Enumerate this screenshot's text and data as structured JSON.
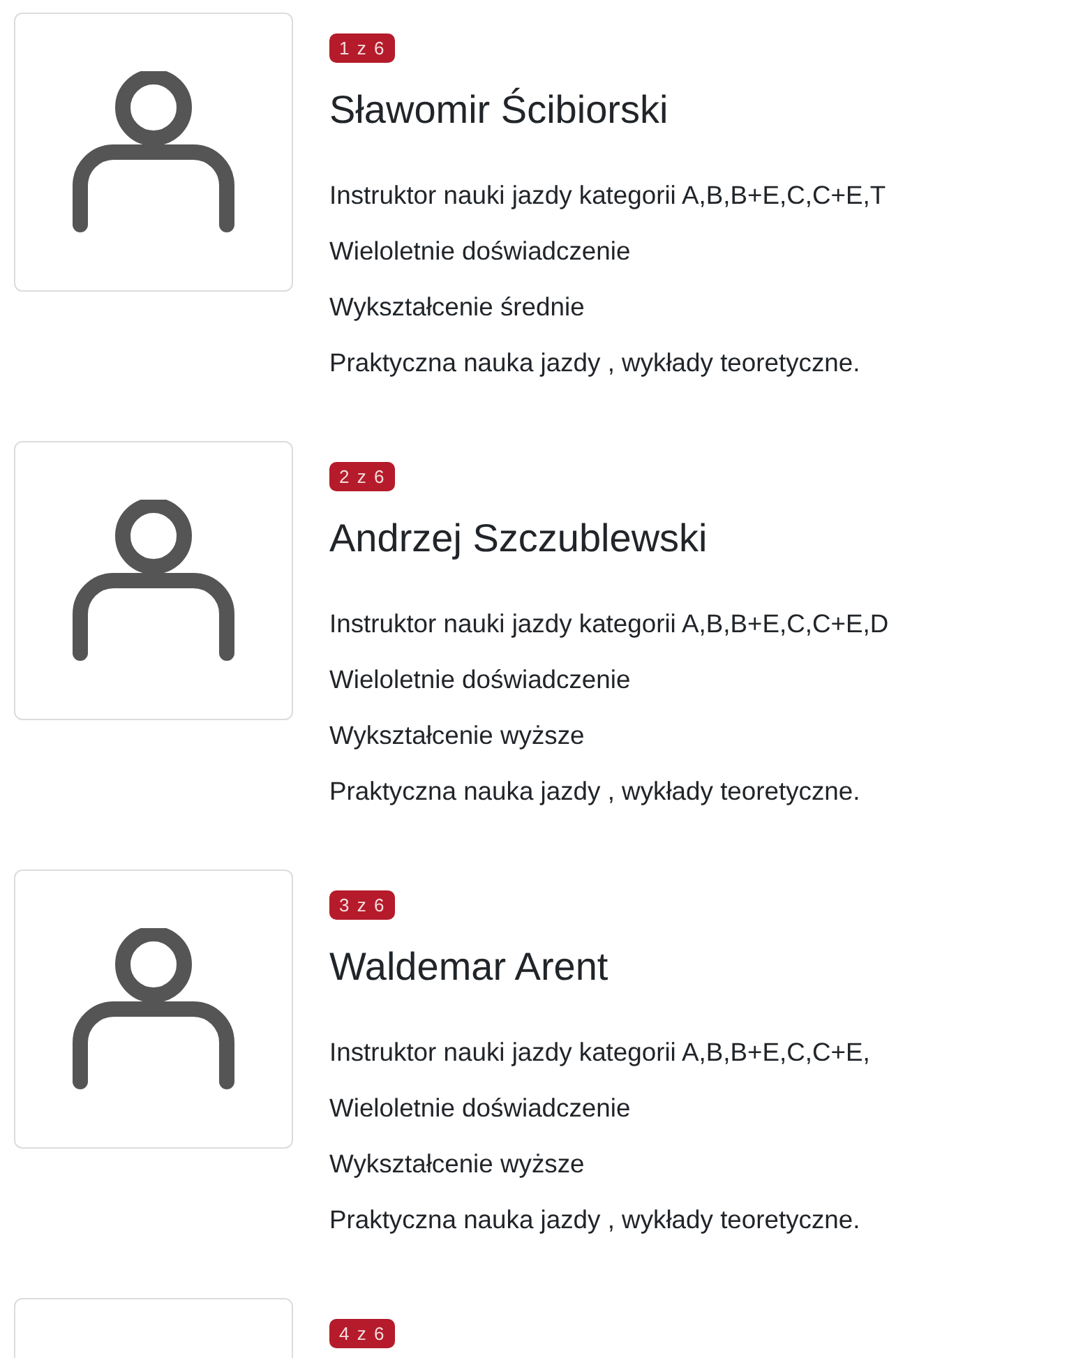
{
  "instructors": [
    {
      "badge": "1 z 6",
      "name": "Sławomir Ścibiorski",
      "lines": [
        "Instruktor nauki jazdy kategorii A,B,B+E,C,C+E,T",
        "Wieloletnie doświadczenie",
        "Wykształcenie średnie",
        "Praktyczna nauka jazdy , wykłady teoretyczne."
      ]
    },
    {
      "badge": "2 z 6",
      "name": "Andrzej Szczublewski",
      "lines": [
        "Instruktor nauki jazdy kategorii A,B,B+E,C,C+E,D",
        "Wieloletnie doświadczenie",
        "Wykształcenie wyższe",
        "Praktyczna nauka jazdy , wykłady teoretyczne."
      ]
    },
    {
      "badge": "3 z 6",
      "name": "Waldemar Arent",
      "lines": [
        "Instruktor nauki jazdy kategorii A,B,B+E,C,C+E,",
        "Wieloletnie doświadczenie",
        "Wykształcenie wyższe",
        "Praktyczna nauka jazdy , wykłady teoretyczne."
      ]
    },
    {
      "badge": "4 z 6"
    }
  ]
}
